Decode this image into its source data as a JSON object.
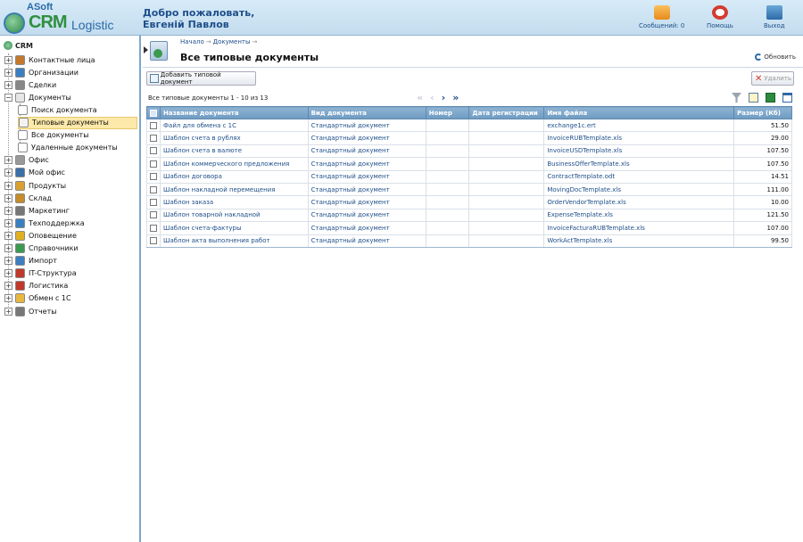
{
  "header": {
    "brand_top": "ASoft",
    "brand_main": "CRM",
    "brand_sub": "Logistic",
    "welcome_line1": "Добро пожаловать,",
    "welcome_line2": "Евгеній Павлов",
    "messages_label": "Сообщений: 0",
    "help_label": "Помощь",
    "exit_label": "Выход"
  },
  "sidebar": {
    "root_label": "CRM",
    "items": [
      {
        "label": "Контактные лица",
        "icon": "contacts-icon",
        "color": "#c47a2a"
      },
      {
        "label": "Организации",
        "icon": "organizations-icon",
        "color": "#3c7fc0"
      },
      {
        "label": "Сделки",
        "icon": "deals-icon",
        "color": "#888888"
      },
      {
        "label": "Документы",
        "icon": "documents-icon",
        "color": "#e6e6e6"
      },
      {
        "label": "Поиск документа",
        "icon": "search-icon",
        "color": "#ffffff"
      },
      {
        "label": "Типовые документы",
        "icon": "template-doc-icon",
        "color": "#f2f2f2"
      },
      {
        "label": "Все документы",
        "icon": "all-docs-icon",
        "color": "#ffffff"
      },
      {
        "label": "Удаленные документы",
        "icon": "deleted-docs-icon",
        "color": "#ffffff"
      },
      {
        "label": "Офис",
        "icon": "office-icon",
        "color": "#999999"
      },
      {
        "label": "Мой офис",
        "icon": "my-office-icon",
        "color": "#3b6fa8"
      },
      {
        "label": "Продукты",
        "icon": "products-icon",
        "color": "#d9a030"
      },
      {
        "label": "Склад",
        "icon": "warehouse-icon",
        "color": "#c48c2a"
      },
      {
        "label": "Маркетинг",
        "icon": "marketing-icon",
        "color": "#777777"
      },
      {
        "label": "Техподдержка",
        "icon": "support-icon",
        "color": "#3c7fc0"
      },
      {
        "label": "Оповещение",
        "icon": "notification-icon",
        "color": "#e0b020"
      },
      {
        "label": "Справочники",
        "icon": "directories-icon",
        "color": "#3a9a50"
      },
      {
        "label": "Импорт",
        "icon": "import-icon",
        "color": "#3c7fc0"
      },
      {
        "label": "IT-Структура",
        "icon": "it-structure-icon",
        "color": "#c0392b"
      },
      {
        "label": "Логистика",
        "icon": "logistics-icon",
        "color": "#c0392b"
      },
      {
        "label": "Обмен с 1С",
        "icon": "exchange-1c-icon",
        "color": "#e8b840"
      },
      {
        "label": "Отчеты",
        "icon": "reports-icon",
        "color": "#777777"
      }
    ]
  },
  "main": {
    "breadcrumb": [
      "Начало",
      "Документы"
    ],
    "title": "Все типовые документы",
    "refresh_label": "Обновить",
    "add_button": "Добавить типовой документ",
    "delete_button": "Удалить",
    "pager_text": "Все типовые документы 1 - 10 из 13"
  },
  "table": {
    "columns": [
      "Название документа",
      "Вид документа",
      "Номер",
      "Дата регистрации",
      "Имя файла",
      "Размер (Кб)"
    ],
    "rows": [
      {
        "name": "Файл для обмена с 1С",
        "type": "Стандартный документ",
        "number": "",
        "date": "",
        "file": "exchange1c.ert",
        "size": "51.50"
      },
      {
        "name": "Шаблон счета в рублях",
        "type": "Стандартный документ",
        "number": "",
        "date": "",
        "file": "InvoiceRUBTemplate.xls",
        "size": "29.00"
      },
      {
        "name": "Шаблон счета в валюте",
        "type": "Стандартный документ",
        "number": "",
        "date": "",
        "file": "InvoiceUSDTemplate.xls",
        "size": "107.50"
      },
      {
        "name": "Шаблон коммерческого предложения",
        "type": "Стандартный документ",
        "number": "",
        "date": "",
        "file": "BusinessOfferTemplate.xls",
        "size": "107.50"
      },
      {
        "name": "Шаблон договора",
        "type": "Стандартный документ",
        "number": "",
        "date": "",
        "file": "ContractTemplate.odt",
        "size": "14.51"
      },
      {
        "name": "Шаблон накладной перемещения",
        "type": "Стандартный документ",
        "number": "",
        "date": "",
        "file": "MovingDocTemplate.xls",
        "size": "111.00"
      },
      {
        "name": "Шаблон заказа",
        "type": "Стандартный документ",
        "number": "",
        "date": "",
        "file": "OrderVendorTemplate.xls",
        "size": "10.00"
      },
      {
        "name": "Шаблон товарной накладной",
        "type": "Стандартный документ",
        "number": "",
        "date": "",
        "file": "ExpenseTemplate.xls",
        "size": "121.50"
      },
      {
        "name": "Шаблон счета-фактуры",
        "type": "Стандартный документ",
        "number": "",
        "date": "",
        "file": "InvoiceFacturaRUBTemplate.xls",
        "size": "107.00"
      },
      {
        "name": "Шаблон акта выполнения работ",
        "type": "Стандартный документ",
        "number": "",
        "date": "",
        "file": "WorkActTemplate.xls",
        "size": "99.50"
      }
    ]
  }
}
